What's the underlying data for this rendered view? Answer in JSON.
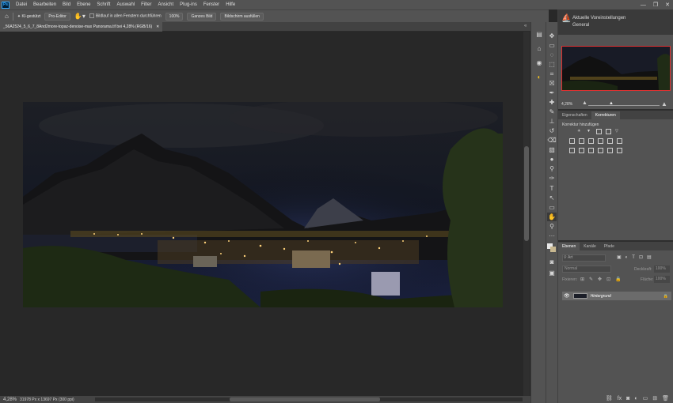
{
  "app": {
    "logo_text": "Ps"
  },
  "menu": [
    "Datei",
    "Bearbeiten",
    "Bild",
    "Ebene",
    "Schrift",
    "Auswahl",
    "Filter",
    "Ansicht",
    "Plug-ins",
    "Fenster",
    "Hilfe"
  ],
  "window_controls": [
    "—",
    "❐",
    "✕"
  ],
  "options_bar": {
    "ai_label": "KI-gestützt",
    "pro_editor": "Pro-Editor",
    "scroll_all_label": "Bildlauf in allen Fenstern durchführen",
    "zoom_100": "100%",
    "fit_screen": "Ganzes Bild",
    "fill_screen": "Bildschirm ausfüllen"
  },
  "document": {
    "tab_title": "_56A2524_5_6_7_8And2more-topaz-denoise-max Panorama.tif bei 4,28% (RGB/16)",
    "close": "✕"
  },
  "status": {
    "zoom": "4,28%",
    "dimensions": "31978 Px x 13697 Px (300 ppi)"
  },
  "learn": {
    "title": "Aktuelle Voreinstellungen",
    "subtitle": "General"
  },
  "navigator": {
    "zoom": "4,28%"
  },
  "adjustments": {
    "tabs": [
      "Eigenschaften",
      "Korrekturen"
    ],
    "active_tab": "Korrekturen",
    "add_label": "Korrektur hinzufügen"
  },
  "layers": {
    "tabs": [
      "Ebenen",
      "Kanäle",
      "Pfade"
    ],
    "active_tab": "Ebenen",
    "filter_placeholder": "Art",
    "blend_mode": "Normal",
    "opacity_label": "Deckkraft:",
    "opacity_value": "100%",
    "lock_label": "Fixieren:",
    "fill_label": "Fläche:",
    "fill_value": "100%",
    "layer_name": "Hintergrund"
  },
  "colors": {
    "accent": "#31a8ff",
    "highlight_border": "#e03030"
  }
}
